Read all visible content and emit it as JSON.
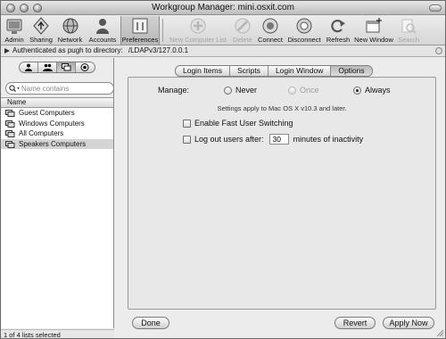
{
  "window": {
    "title": "Workgroup Manager: mini.osxit.com"
  },
  "toolbar": {
    "items": [
      {
        "label": "Admin",
        "icon": "admin-icon",
        "enabled": true,
        "selected": false
      },
      {
        "label": "Sharing",
        "icon": "sharing-icon",
        "enabled": true,
        "selected": false
      },
      {
        "label": "Network",
        "icon": "network-icon",
        "enabled": true,
        "selected": false
      },
      {
        "label": "Accounts",
        "icon": "accounts-icon",
        "enabled": true,
        "selected": false
      },
      {
        "label": "Preferences",
        "icon": "preferences-icon",
        "enabled": true,
        "selected": true
      },
      {
        "label": "New Computer List",
        "icon": "add-icon",
        "enabled": false,
        "selected": false
      },
      {
        "label": "Delete",
        "icon": "delete-icon",
        "enabled": false,
        "selected": false
      },
      {
        "label": "Connect",
        "icon": "connect-icon",
        "enabled": true,
        "selected": false
      },
      {
        "label": "Disconnect",
        "icon": "disconnect-icon",
        "enabled": true,
        "selected": false
      },
      {
        "label": "Refresh",
        "icon": "refresh-icon",
        "enabled": true,
        "selected": false
      },
      {
        "label": "New Window",
        "icon": "new-window-icon",
        "enabled": true,
        "selected": false
      },
      {
        "label": "Search",
        "icon": "search-icon",
        "enabled": false,
        "selected": false
      }
    ]
  },
  "auth": {
    "prefix": "Authenticated as pugh to directory:",
    "directory": "/LDAPv3/127.0.0.1"
  },
  "sidebar": {
    "segments": [
      {
        "icon": "user-icon",
        "active": false
      },
      {
        "icon": "group-icon",
        "active": false
      },
      {
        "icon": "computer-list-icon",
        "active": true
      },
      {
        "icon": "target-icon",
        "active": false
      }
    ],
    "search_placeholder": "Name contains",
    "column_header": "Name",
    "items": [
      {
        "label": "Guest Computers",
        "selected": false
      },
      {
        "label": "Windows Computers",
        "selected": false
      },
      {
        "label": "All Computers",
        "selected": false
      },
      {
        "label": "Speakers Computers",
        "selected": true
      }
    ],
    "status": "1 of 4 lists selected"
  },
  "tabs": [
    {
      "label": "Login Items",
      "active": false
    },
    {
      "label": "Scripts",
      "active": false
    },
    {
      "label": "Login Window",
      "active": false
    },
    {
      "label": "Options",
      "active": true
    }
  ],
  "options": {
    "manage_label": "Manage:",
    "radio": {
      "never": "Never",
      "once": "Once",
      "always": "Always",
      "selected": "always",
      "disabled": [
        "once"
      ]
    },
    "note": "Settings apply to Mac OS X v10.3 and later.",
    "fast_user_switching": {
      "label": "Enable Fast User Switching",
      "checked": false
    },
    "logout": {
      "label": "Log out users after:",
      "checked": false,
      "minutes": "30",
      "suffix": "minutes of inactivity"
    }
  },
  "buttons": {
    "done": "Done",
    "revert": "Revert",
    "apply": "Apply Now"
  },
  "colors": {
    "window_bg": "#ececec",
    "selection": "#d4d4d4",
    "disabled_text": "#a6a6a6"
  }
}
